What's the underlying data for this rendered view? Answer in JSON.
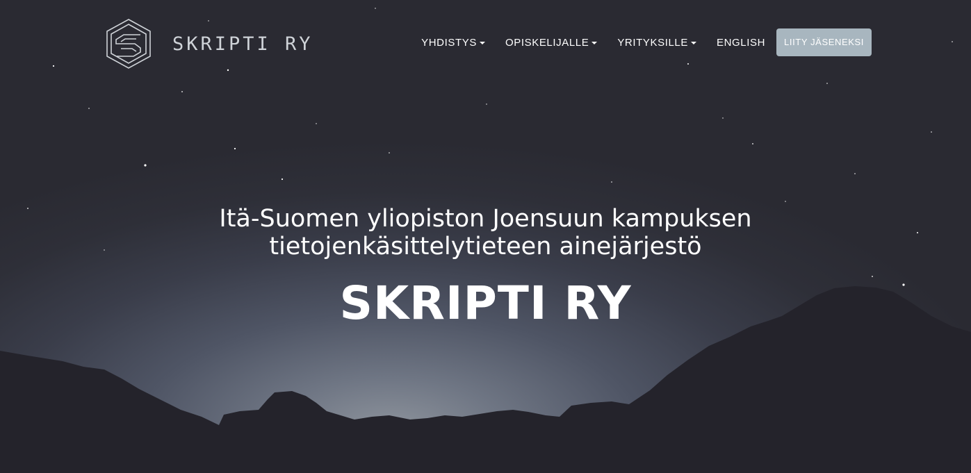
{
  "brand": {
    "name": "SKRIPTI RY",
    "logo_icon": "skripti-hexagon-s-logo"
  },
  "nav": {
    "items": [
      {
        "label": "YHDISTYS",
        "dropdown": true
      },
      {
        "label": "OPISKELIJALLE",
        "dropdown": true
      },
      {
        "label": "YRITYKSILLE",
        "dropdown": true
      },
      {
        "label": "ENGLISH",
        "dropdown": false
      }
    ],
    "join_label": "LIITY JÄSENEKSI"
  },
  "hero": {
    "subtitle_line1": "Itä-Suomen yliopiston Joensuun kampuksen",
    "subtitle_line2": "tietojenkäsittelytieteen ainejärjestö",
    "title": "SKRIPTI RY"
  },
  "colors": {
    "join_button": "#a8b6bf",
    "sky_dark": "#2a2a32",
    "mountains": "#24232b"
  }
}
